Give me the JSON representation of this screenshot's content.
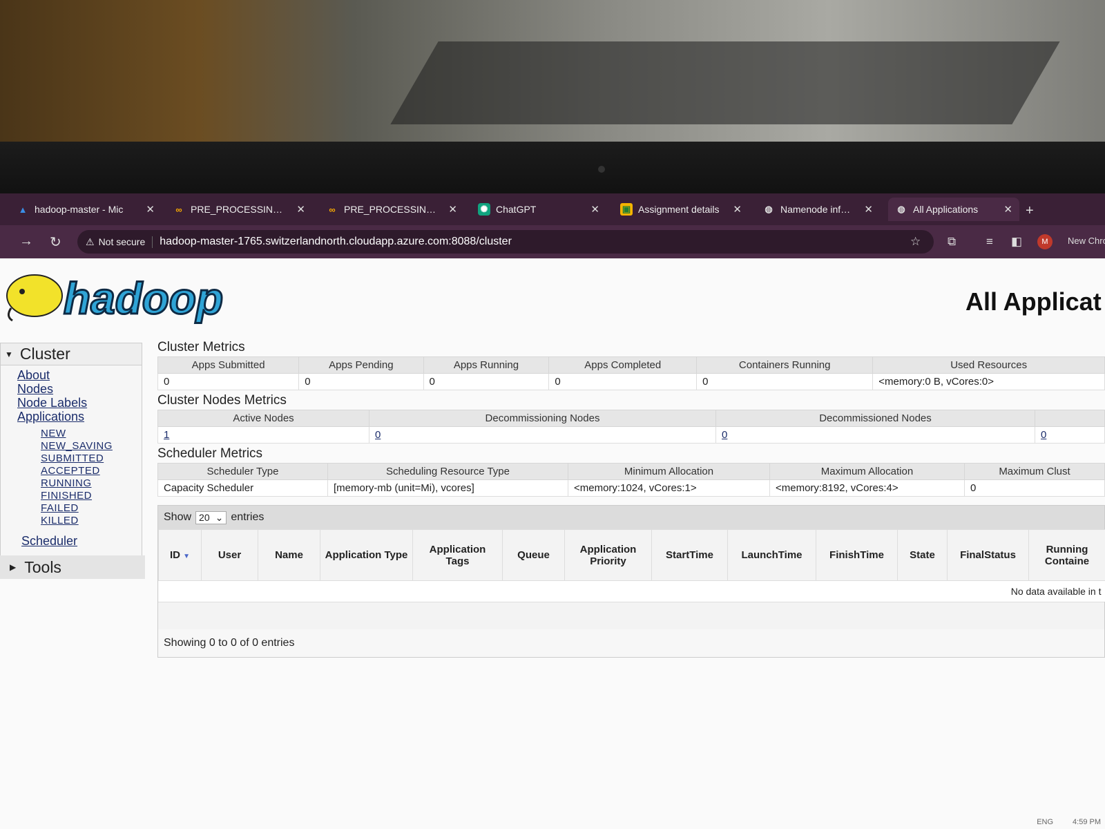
{
  "browser": {
    "tabs": [
      {
        "label": "hadoop-master - Mic",
        "icon": "azure-icon",
        "active": false
      },
      {
        "label": "PRE_PROCESSING_D",
        "icon": "colab-icon",
        "active": false
      },
      {
        "label": "PRE_PROCESSING_D",
        "icon": "colab-icon",
        "active": false
      },
      {
        "label": "ChatGPT",
        "icon": "chatgpt-icon",
        "active": false
      },
      {
        "label": "Assignment details",
        "icon": "classroom-icon",
        "active": false
      },
      {
        "label": "Namenode informat",
        "icon": "globe-icon",
        "active": false
      },
      {
        "label": "All Applications",
        "icon": "globe-icon",
        "active": true
      }
    ],
    "security_label": "Not secure",
    "url": "hadoop-master-1765.switzerlandnorth.cloudapp.azure.com:8088/cluster",
    "profile_initial": "M",
    "new_chrome_label": "New Chro"
  },
  "page": {
    "logo_text": "hadoop",
    "title": "All Applicat"
  },
  "sidebar": {
    "cluster_label": "Cluster",
    "links": [
      "About",
      "Nodes",
      "Node Labels",
      "Applications"
    ],
    "app_states": [
      "NEW",
      "NEW_SAVING",
      "SUBMITTED",
      "ACCEPTED",
      "RUNNING",
      "FINISHED",
      "FAILED",
      "KILLED"
    ],
    "scheduler_label": "Scheduler",
    "tools_label": "Tools"
  },
  "cluster_metrics": {
    "title": "Cluster Metrics",
    "headers": [
      "Apps Submitted",
      "Apps Pending",
      "Apps Running",
      "Apps Completed",
      "Containers Running",
      "Used Resources"
    ],
    "values": [
      "0",
      "0",
      "0",
      "0",
      "0",
      "<memory:0 B, vCores:0>"
    ]
  },
  "node_metrics": {
    "title": "Cluster Nodes Metrics",
    "headers": [
      "Active Nodes",
      "Decommissioning Nodes",
      "Decommissioned Nodes",
      ""
    ],
    "values": [
      "1",
      "0",
      "0",
      "0"
    ]
  },
  "scheduler_metrics": {
    "title": "Scheduler Metrics",
    "headers": [
      "Scheduler Type",
      "Scheduling Resource Type",
      "Minimum Allocation",
      "Maximum Allocation",
      "Maximum Clust"
    ],
    "values": [
      "Capacity Scheduler",
      "[memory-mb (unit=Mi), vcores]",
      "<memory:1024, vCores:1>",
      "<memory:8192, vCores:4>",
      "0"
    ]
  },
  "apps_table": {
    "show_label": "Show",
    "page_size": "20",
    "entries_label": "entries",
    "columns": [
      "ID",
      "User",
      "Name",
      "Application Type",
      "Application Tags",
      "Queue",
      "Application Priority",
      "StartTime",
      "LaunchTime",
      "FinishTime",
      "State",
      "FinalStatus",
      "Running Containe"
    ],
    "empty_text": "No data available in t",
    "footer": "Showing 0 to 0 of 0 entries"
  },
  "taskbar": {
    "lang": "ENG",
    "time": "4:59 PM"
  }
}
